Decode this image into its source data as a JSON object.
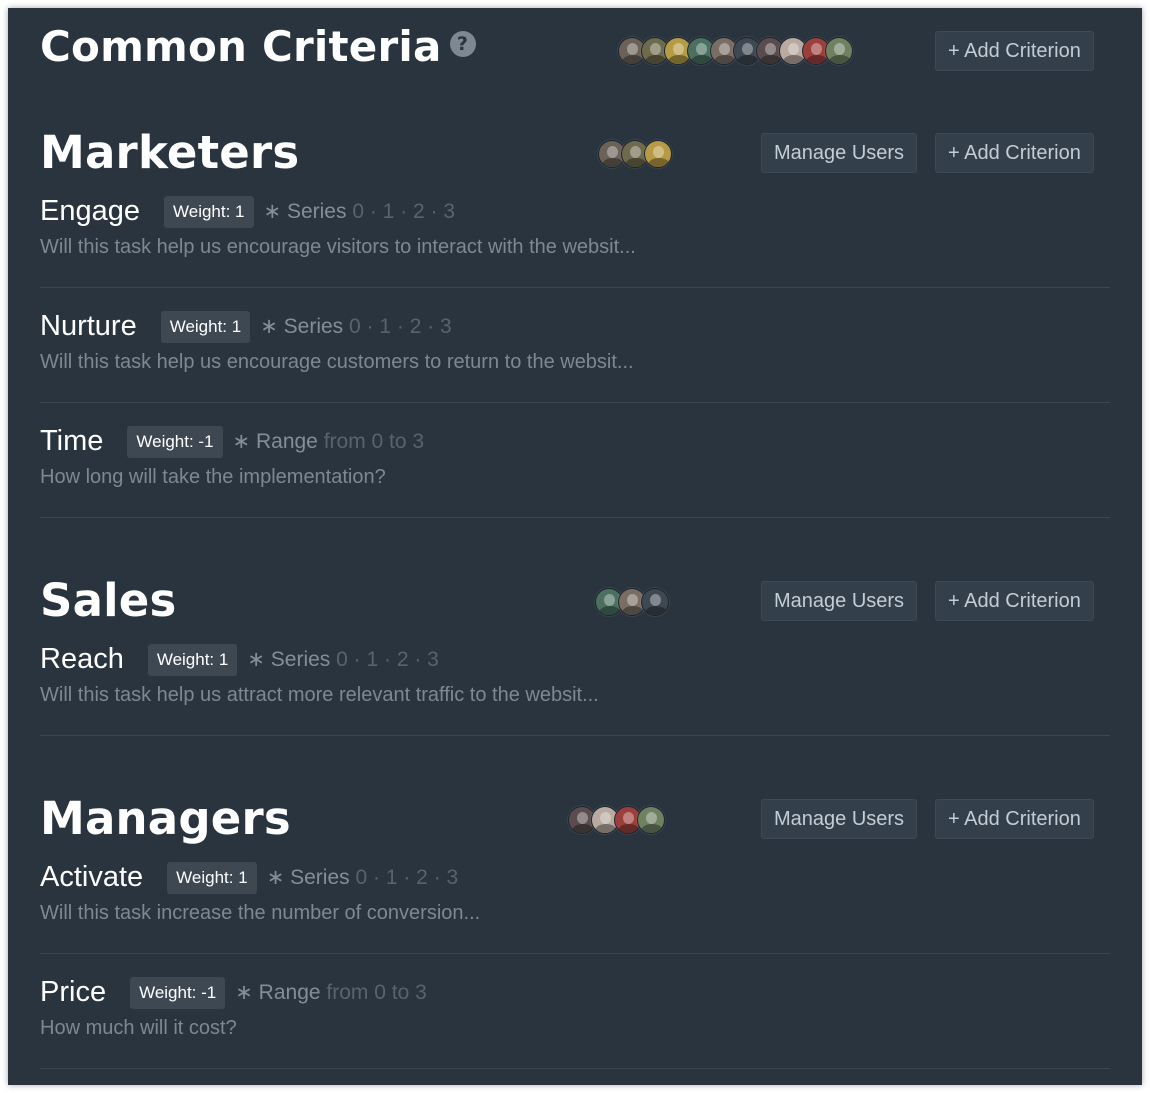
{
  "common": {
    "title": "Common Criteria",
    "help": "?",
    "add_label": "+ Add Criterion",
    "avatar_colors": [
      "#6b6159",
      "#6e6a4e",
      "#b69a45",
      "#4b7060",
      "#7a6d65",
      "#3e4852",
      "#5a4c4e",
      "#b9a9a0",
      "#9b3f3c",
      "#6e8262"
    ]
  },
  "groups": [
    {
      "title": "Marketers",
      "manage_label": "Manage Users",
      "add_label": "+ Add Criterion",
      "avatar_colors": [
        "#6b6159",
        "#6e6a4e",
        "#b69a45"
      ],
      "criteria": [
        {
          "name": "Engage",
          "weight": "Weight: 1",
          "kind": "∗ Series",
          "values": "0 · 1 · 2 · 3",
          "desc": "Will this task help us encourage visitors to interact with the websit..."
        },
        {
          "name": "Nurture",
          "weight": "Weight: 1",
          "kind": "∗ Series",
          "values": "0 · 1 · 2 · 3",
          "desc": "Will this task help us encourage customers to return to the websit..."
        },
        {
          "name": "Time",
          "weight": "Weight: -1",
          "kind": "∗ Range",
          "values": "from 0 to 3",
          "desc": "How long will take the implementation?"
        }
      ]
    },
    {
      "title": "Sales",
      "manage_label": "Manage Users",
      "add_label": "+ Add Criterion",
      "avatar_colors": [
        "#4b7060",
        "#7a6d65",
        "#3e4852"
      ],
      "criteria": [
        {
          "name": "Reach",
          "weight": "Weight: 1",
          "kind": "∗ Series",
          "values": "0 · 1 · 2 · 3",
          "desc": "Will this task help us attract more relevant traffic to the websit..."
        }
      ]
    },
    {
      "title": "Managers",
      "manage_label": "Manage Users",
      "add_label": "+ Add Criterion",
      "avatar_colors": [
        "#5a4c4e",
        "#b9a9a0",
        "#9b3f3c",
        "#6e8262"
      ],
      "criteria": [
        {
          "name": "Activate",
          "weight": "Weight: 1",
          "kind": "∗ Series",
          "values": "0 · 1 · 2 · 3",
          "desc": "Will this task increase the number of conversion..."
        },
        {
          "name": "Price",
          "weight": "Weight: -1",
          "kind": "∗ Range",
          "values": "from 0 to 3",
          "desc": "How much will it cost?"
        }
      ]
    }
  ]
}
